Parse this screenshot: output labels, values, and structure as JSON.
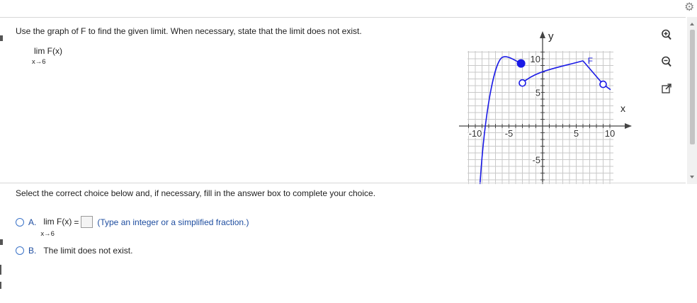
{
  "question": {
    "prompt": "Use the graph of F to find the given limit. When necessary, state that the limit does not exist.",
    "limit_expr": "lim F(x)",
    "limit_sub": "x→6"
  },
  "graph": {
    "y_axis_label": "y",
    "x_axis_label": "x",
    "function_label": "F",
    "x_ticks": [
      "-10",
      "-5",
      "5",
      "10"
    ],
    "y_ticks": [
      "10",
      "5",
      "-5"
    ]
  },
  "tools": [
    {
      "name": "zoom-in-icon"
    },
    {
      "name": "zoom-out-icon"
    },
    {
      "name": "popout-icon"
    }
  ],
  "instruction": "Select the correct choice below and, if necessary, fill in the answer box to complete your choice.",
  "choices": {
    "a": {
      "letter": "A.",
      "limit_expr": "lim F(x)",
      "limit_sub": "x→6",
      "equals": "=",
      "answer_value": "",
      "hint": "(Type an integer or a simplified fraction.)"
    },
    "b": {
      "letter": "B.",
      "text": "The limit does not exist."
    }
  },
  "colors": {
    "curve": "#1a1ae6",
    "link": "#1f4ea0",
    "radio": "#3b73c8"
  }
}
